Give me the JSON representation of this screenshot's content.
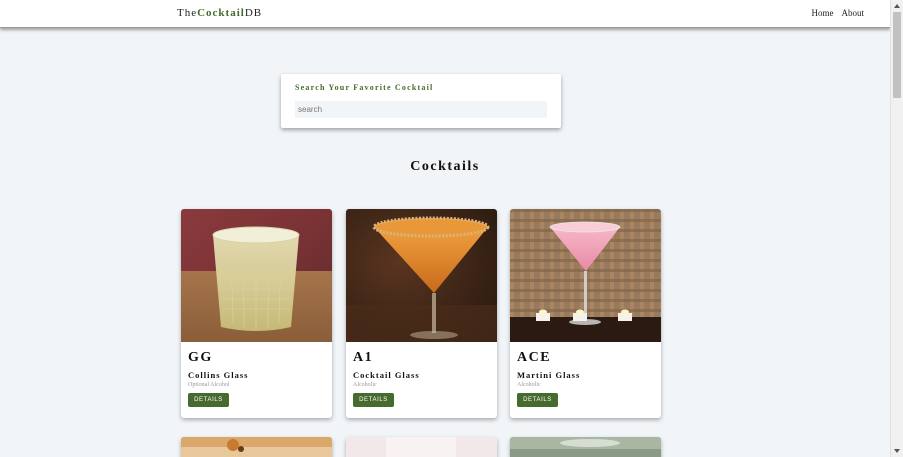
{
  "navbar": {
    "logo_prefix": "The",
    "logo_accent": "Cocktail",
    "logo_suffix": "DB",
    "links": [
      "Home",
      "About"
    ]
  },
  "search": {
    "label": "Search Your Favorite Cocktail",
    "placeholder": "search",
    "value": ""
  },
  "section": {
    "title": "Cocktails"
  },
  "cocktails": [
    {
      "name": "GG",
      "glass": "Collins Glass",
      "alcoholic": "Optional Alcohol",
      "button": "DETAILS"
    },
    {
      "name": "A1",
      "glass": "Cocktail Glass",
      "alcoholic": "Alcoholic",
      "button": "DETAILS"
    },
    {
      "name": "ACE",
      "glass": "Martini Glass",
      "alcoholic": "Alcoholic",
      "button": "DETAILS"
    }
  ],
  "colors": {
    "accent": "#476a2e",
    "background": "#f1f5f8",
    "card": "#ffffff"
  }
}
